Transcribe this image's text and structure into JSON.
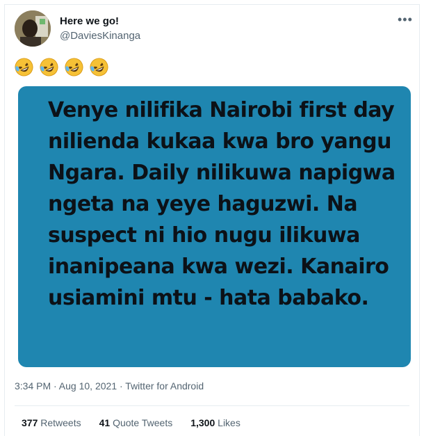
{
  "tweet": {
    "display_name": "Here we go!",
    "handle": "@DaviesKinanga",
    "emoji_count": 4,
    "emoji_name": "rolling-on-the-floor-laughing",
    "image_text": "Venye nilifika Nairobi first day nilienda kukaa kwa bro yangu Ngara. Daily nilikuwa napigwa ngeta na yeye haguzwi. Na suspect ni hio nugu ilikuwa inanipeana kwa wezi.  Kanairo usiamini mtu - hata babako.",
    "timestamp": "3:34 PM · Aug 10, 2021 · Twitter for Android"
  },
  "stats": {
    "retweets_count": "377",
    "retweets_label": "Retweets",
    "quotes_count": "41",
    "quotes_label": "Quote Tweets",
    "likes_count": "1,300",
    "likes_label": "Likes"
  },
  "colors": {
    "image_background": "#1f86b0",
    "secondary_text": "#536471"
  },
  "icons": {
    "more": "more-options-icon"
  }
}
